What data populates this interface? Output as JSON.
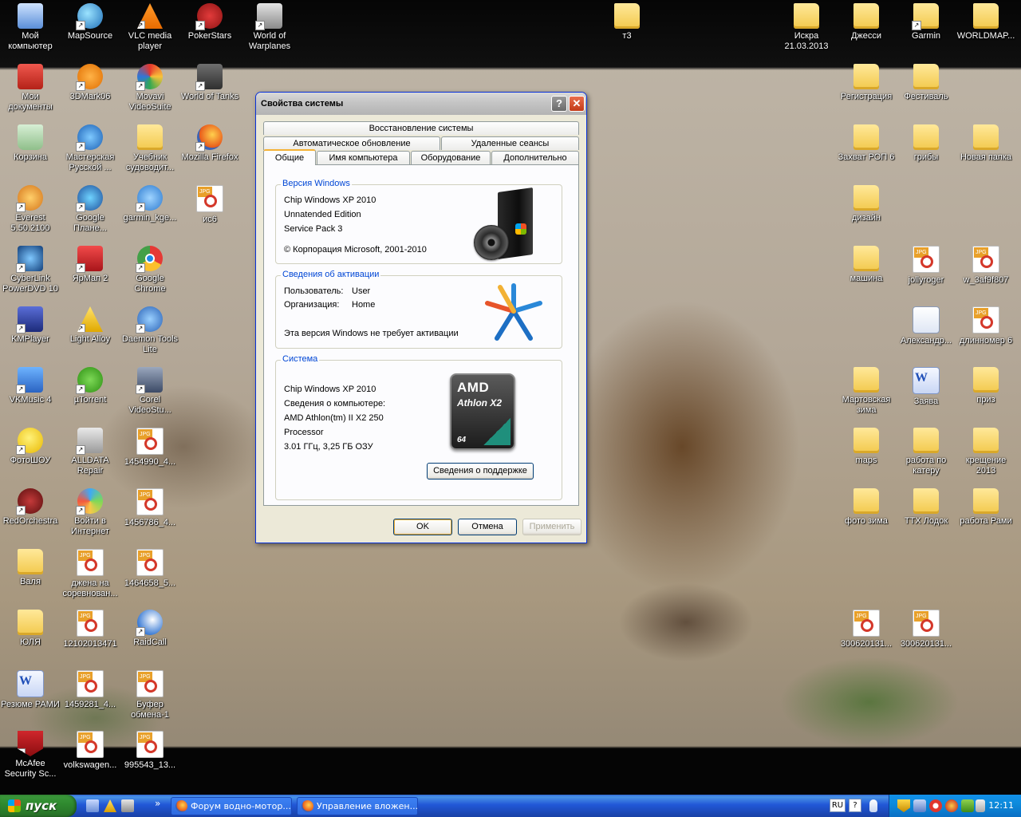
{
  "desktop": {
    "left_column_icons": [
      {
        "label": "Мой компьютер"
      },
      {
        "label": "MapSource"
      },
      {
        "label": "VLC media player"
      },
      {
        "label": "PokerStars"
      },
      {
        "label": "World of Warplanes"
      },
      {
        "label": "Мои документы"
      },
      {
        "label": "3DMark06"
      },
      {
        "label": "Movavi VideoSuite"
      },
      {
        "label": "World of Tanks"
      },
      {
        "label": "Корзина"
      },
      {
        "label": "Мастерская Русской ..."
      },
      {
        "label": "Учебник судоводит..."
      },
      {
        "label": "Mozilla Firefox"
      },
      {
        "label": "Everest 5.50.2100"
      },
      {
        "label": "Google Плане..."
      },
      {
        "label": "garmin_kge..."
      },
      {
        "label": "ис6"
      },
      {
        "label": "CyberLink PowerDVD 10"
      },
      {
        "label": "ЯрМап 2"
      },
      {
        "label": "Google Chrome"
      },
      {
        "label": "KMPlayer"
      },
      {
        "label": "Light Alloy"
      },
      {
        "label": "Daemon Tools Lite"
      },
      {
        "label": "VKMusic 4"
      },
      {
        "label": "µTorrent"
      },
      {
        "label": "Corel VideoStu..."
      },
      {
        "label": "ФотоШОУ"
      },
      {
        "label": "ALLDATA Repair"
      },
      {
        "label": "1454990_4..."
      },
      {
        "label": "RedOrchestra"
      },
      {
        "label": "Войти в Интернет"
      },
      {
        "label": "1456786_4..."
      },
      {
        "label": "Валя"
      },
      {
        "label": "джена на соревнован..."
      },
      {
        "label": "1464658_5..."
      },
      {
        "label": "ЮЛЯ"
      },
      {
        "label": "12102013471"
      },
      {
        "label": "RaidCall"
      },
      {
        "label": "Резюме РАМИ"
      },
      {
        "label": "1459281_4..."
      },
      {
        "label": "Буфер обмена-1"
      },
      {
        "label": "McAfee Security Sc..."
      },
      {
        "label": "volkswagen..."
      },
      {
        "label": "995543_13..."
      }
    ],
    "right_column_icons": [
      {
        "label": "т3"
      },
      {
        "label": "Искра 21.03.2013"
      },
      {
        "label": "Джесси"
      },
      {
        "label": "Garmin"
      },
      {
        "label": "WORLDMAP..."
      },
      {
        "label": "Регистрация"
      },
      {
        "label": "Фестиваль"
      },
      {
        "label": "Захват РОП 6"
      },
      {
        "label": "грибы"
      },
      {
        "label": "Новая папка"
      },
      {
        "label": "дизайн"
      },
      {
        "label": "машина"
      },
      {
        "label": "jollyroger"
      },
      {
        "label": "w_3af9f807"
      },
      {
        "label": "Александр..."
      },
      {
        "label": "длинномер 6"
      },
      {
        "label": "Мартовская зима"
      },
      {
        "label": "Заява"
      },
      {
        "label": "приз"
      },
      {
        "label": "maps"
      },
      {
        "label": "работа по катеру"
      },
      {
        "label": "крещение 2013"
      },
      {
        "label": "фото зима"
      },
      {
        "label": "ТТХ Лодок"
      },
      {
        "label": "работа Рами"
      },
      {
        "label": "300620131..."
      },
      {
        "label": "300620131..."
      }
    ]
  },
  "dialog": {
    "title": "Свойства системы",
    "help_button": "?",
    "close_button": "✕",
    "tabs_row1": [
      "Восстановление системы"
    ],
    "tabs_row2": [
      "Автоматическое обновление",
      "Удаленные сеансы"
    ],
    "tabs_row3": [
      "Общие",
      "Имя компьютера",
      "Оборудование",
      "Дополнительно"
    ],
    "active_tab": "Общие",
    "windows_version": {
      "legend": "Версия Windows",
      "lines": [
        "Chip Windows XP 2010",
        "Unnatended Edition",
        "Service Pack 3",
        "© Корпорация Microsoft, 2001-2010"
      ]
    },
    "activation": {
      "legend": "Сведения об активации",
      "user_label": "Пользователь:",
      "user_value": "User",
      "org_label": "Организация:",
      "org_value": "Home",
      "note": "Эта версия Windows не требует активации"
    },
    "system": {
      "legend": "Система",
      "lines": [
        "Chip Windows XP 2010",
        "Сведения о компьютере:",
        "AMD Athlon(tm) II X2 250",
        "Processor",
        "3.01 ГГц, 3,25 ГБ ОЗУ"
      ],
      "support_button": "Сведения о поддержке",
      "chip_brand": "AMD",
      "chip_model": "Athlon X2",
      "chip_bits": "64"
    },
    "buttons": {
      "ok": "OK",
      "cancel": "Отмена",
      "apply": "Применить"
    }
  },
  "taskbar": {
    "start_label": "пуск",
    "quick_launch_more": "»",
    "tasks": [
      {
        "label": "Форум водно-мотор..."
      },
      {
        "label": "Управление вложен..."
      }
    ],
    "language": "RU",
    "help": "?",
    "clock": "12:11"
  },
  "colors": {
    "title_text": "#000000",
    "legend_blue": "#0046d5",
    "taskbar_blue": "#245edb",
    "start_green": "#3c9a3c"
  }
}
